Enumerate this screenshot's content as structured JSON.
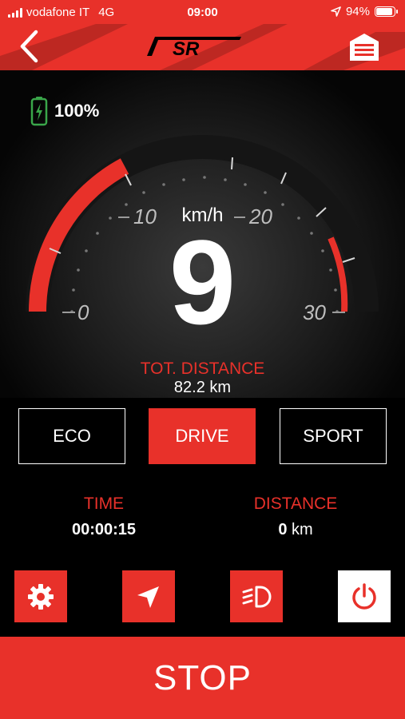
{
  "status_bar": {
    "carrier": "vodafone IT",
    "network": "4G",
    "time": "09:00",
    "battery": "94%"
  },
  "header": {
    "logo_text": "SR",
    "back_icon": "chevron-left-icon",
    "garage_icon": "garage-icon"
  },
  "dashboard": {
    "battery_level": "100%",
    "speed_unit": "km/h",
    "speed": "9",
    "gauge_labels": [
      "0",
      "10",
      "20",
      "30"
    ],
    "total_distance_label": "TOT. DISTANCE",
    "total_distance_value": "82.2 km"
  },
  "modes": [
    {
      "label": "ECO",
      "active": false
    },
    {
      "label": "DRIVE",
      "active": true
    },
    {
      "label": "SPORT",
      "active": false
    }
  ],
  "trip": {
    "time_label": "TIME",
    "time_value": "00:00:15",
    "distance_label": "DISTANCE",
    "distance_number": "0",
    "distance_unit": "km"
  },
  "actions": {
    "settings_icon": "gear-icon",
    "navigation_icon": "navigation-arrow-icon",
    "light_icon": "headlight-icon",
    "power_icon": "power-icon"
  },
  "stop_label": "STOP",
  "colors": {
    "accent": "#e8312a",
    "battery_green": "#3aa64a",
    "background": "#000000"
  }
}
